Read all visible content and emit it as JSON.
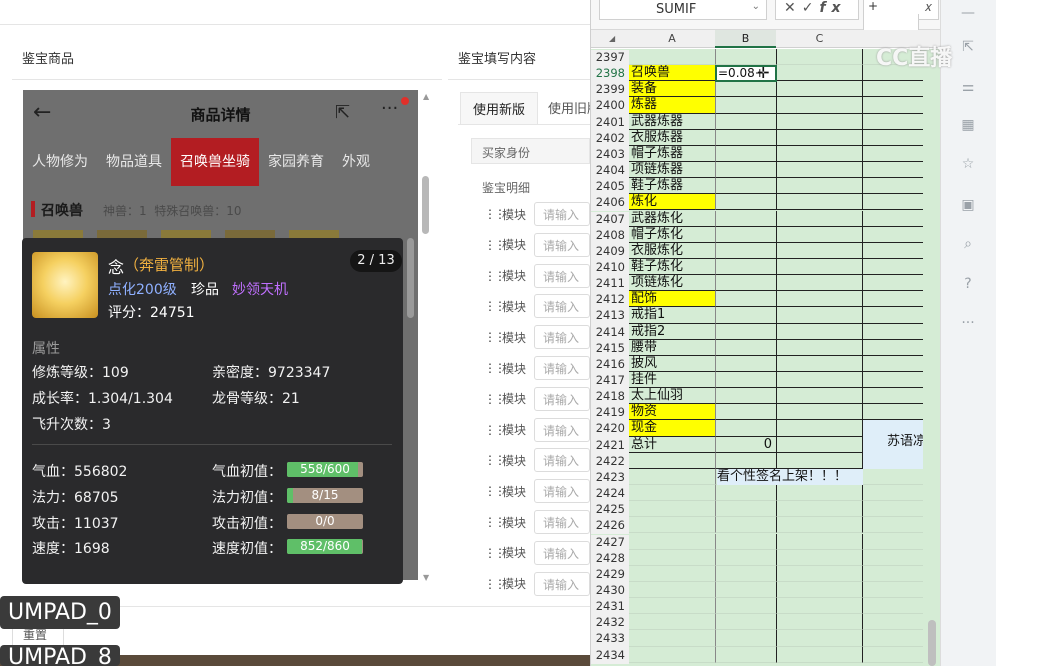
{
  "left_page": {
    "section_title": "鉴宝商品",
    "right_section_title": "鉴宝填写内容",
    "tabs": [
      "使用新版",
      "使用旧版"
    ],
    "buyer_label": "买家身份",
    "detail_label": "鉴宝明细",
    "module_label": "模块",
    "input_placeholder": "请输入",
    "module_rows": 13
  },
  "phone": {
    "title": "商品详情",
    "categories": [
      "人物修为",
      "物品道具",
      "召唤兽坐骑",
      "家园养育",
      "外观"
    ],
    "active_category": 2,
    "summon_label": "召唤兽",
    "summon_sub": "神兽：1  特殊召唤兽：10"
  },
  "card": {
    "name": "念",
    "tag": "（奔雷管制）",
    "page": "2 / 13",
    "level": "点化200级",
    "rarity": "珍品",
    "skill": "妙领天机",
    "score": "评分：24751",
    "attr_title": "属性",
    "attrs_left": [
      "修炼等级：109",
      "成长率：1.304/1.304",
      "飞升次数：3"
    ],
    "attrs_right": [
      "亲密度：9723347",
      "龙骨等级：21"
    ],
    "stats_left": [
      "气血：556802",
      "法力：68705",
      "攻击：11037",
      "速度：1698"
    ],
    "stats_right_labels": [
      "气血初值：",
      "法力初值：",
      "攻击初值：",
      "速度初值："
    ],
    "stats_bars": [
      {
        "text": "558/600",
        "ratio": 0.93
      },
      {
        "text": "8/15",
        "ratio": 0.08
      },
      {
        "text": "0/0",
        "ratio": 0.0
      },
      {
        "text": "852/860",
        "ratio": 0.99
      }
    ]
  },
  "sheet": {
    "name_box": "SUMIF",
    "formula_prefix": "+",
    "columns": [
      "A",
      "B",
      "C"
    ],
    "rows": [
      {
        "n": "2397",
        "a": "",
        "yellow": false
      },
      {
        "n": "2398",
        "a": "召唤兽",
        "yellow": true
      },
      {
        "n": "2399",
        "a": "装备",
        "yellow": true
      },
      {
        "n": "2400",
        "a": "炼器",
        "yellow": true
      },
      {
        "n": "2401",
        "a": "武器炼器",
        "yellow": false
      },
      {
        "n": "2402",
        "a": "衣服炼器",
        "yellow": false
      },
      {
        "n": "2403",
        "a": "帽子炼器",
        "yellow": false
      },
      {
        "n": "2404",
        "a": "项链炼器",
        "yellow": false
      },
      {
        "n": "2405",
        "a": "鞋子炼器",
        "yellow": false
      },
      {
        "n": "2406",
        "a": "炼化",
        "yellow": true
      },
      {
        "n": "2407",
        "a": "武器炼化",
        "yellow": false
      },
      {
        "n": "2408",
        "a": "帽子炼化",
        "yellow": false
      },
      {
        "n": "2409",
        "a": "衣服炼化",
        "yellow": false
      },
      {
        "n": "2410",
        "a": "鞋子炼化",
        "yellow": false
      },
      {
        "n": "2411",
        "a": "项链炼化",
        "yellow": false
      },
      {
        "n": "2412",
        "a": "配饰",
        "yellow": true
      },
      {
        "n": "2413",
        "a": "戒指1",
        "yellow": false
      },
      {
        "n": "2414",
        "a": "戒指2",
        "yellow": false
      },
      {
        "n": "2415",
        "a": "腰带",
        "yellow": false
      },
      {
        "n": "2416",
        "a": "披风",
        "yellow": false
      },
      {
        "n": "2417",
        "a": "挂件",
        "yellow": false
      },
      {
        "n": "2418",
        "a": "太上仙羽",
        "yellow": false
      },
      {
        "n": "2419",
        "a": "物资",
        "yellow": true
      },
      {
        "n": "2420",
        "a": "现金",
        "yellow": true
      },
      {
        "n": "2421",
        "a": "总计",
        "yellow": false
      },
      {
        "n": "2422",
        "a": "",
        "yellow": false
      },
      {
        "n": "2423",
        "a": "",
        "yellow": false
      },
      {
        "n": "2424",
        "a": "",
        "yellow": false
      },
      {
        "n": "2425",
        "a": "",
        "yellow": false
      },
      {
        "n": "2426",
        "a": "",
        "yellow": false
      },
      {
        "n": "2427",
        "a": "",
        "yellow": false
      },
      {
        "n": "2428",
        "a": "",
        "yellow": false
      },
      {
        "n": "2429",
        "a": "",
        "yellow": false
      },
      {
        "n": "2430",
        "a": "",
        "yellow": false
      },
      {
        "n": "2431",
        "a": "",
        "yellow": false
      },
      {
        "n": "2432",
        "a": "",
        "yellow": false
      },
      {
        "n": "2433",
        "a": "",
        "yellow": false
      },
      {
        "n": "2434",
        "a": "",
        "yellow": false
      }
    ],
    "editing_cell_value": "=0.08+",
    "total_value": "0",
    "note_text": "看个性签名上架！！！",
    "side_text": "苏语凉"
  },
  "watermark": "CC直播",
  "overlays": [
    "UMPAD_0",
    "UMPAD_8"
  ],
  "sub_button": "重置",
  "colors": {
    "accent_red": "#b31d22",
    "yellow": "#ffff00",
    "sheet_green": "#d5ecd5",
    "bar_green": "#5fbf68",
    "bar_bg": "#a38f80",
    "purple": "#c070ff",
    "blue_level": "#8fb0ff",
    "orange_tag": "#f0b040"
  }
}
